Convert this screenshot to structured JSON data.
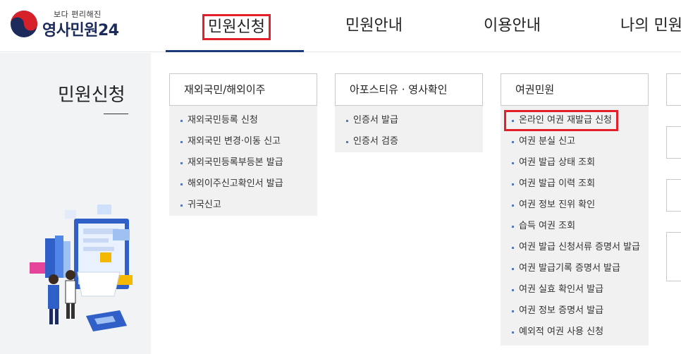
{
  "header": {
    "logo_sub": "보다 편리해진",
    "logo_main": "영사민원24",
    "nav": [
      {
        "label": "민원신청",
        "active": true
      },
      {
        "label": "민원안내"
      },
      {
        "label": "이용안내"
      },
      {
        "label": "나의 민원"
      }
    ]
  },
  "sidebar": {
    "title": "민원신청"
  },
  "columns": [
    {
      "title": "재외국민/해외이주",
      "items": [
        "재외국민등록 신청",
        "재외국민 변경·이동 신고",
        "재외국민등록부등본 발급",
        "해외이주신고확인서 발급",
        "귀국신고"
      ]
    },
    {
      "title": "아포스티유 · 영사확인",
      "items": [
        "인증서 발급",
        "인증서 검증"
      ]
    },
    {
      "title": "여권민원",
      "items": [
        "온라인 여권 재발급 신청",
        "여권 분실 신고",
        "여권 발급 상태 조회",
        "여권 발급 이력 조회",
        "여권 정보 진위 확인",
        "습득 여권 조회",
        "여권 발급 신청서류 증명서 발급",
        "여권 발급기록 증명서 발급",
        "여권 실효 확인서 발급",
        "여권 정보 증명서 발급",
        "예외적 여권 사용 신청"
      ]
    }
  ],
  "colors": {
    "highlight": "#e3202a",
    "brand": "#1c2a5c",
    "active_bar": "#1c3a7a"
  }
}
